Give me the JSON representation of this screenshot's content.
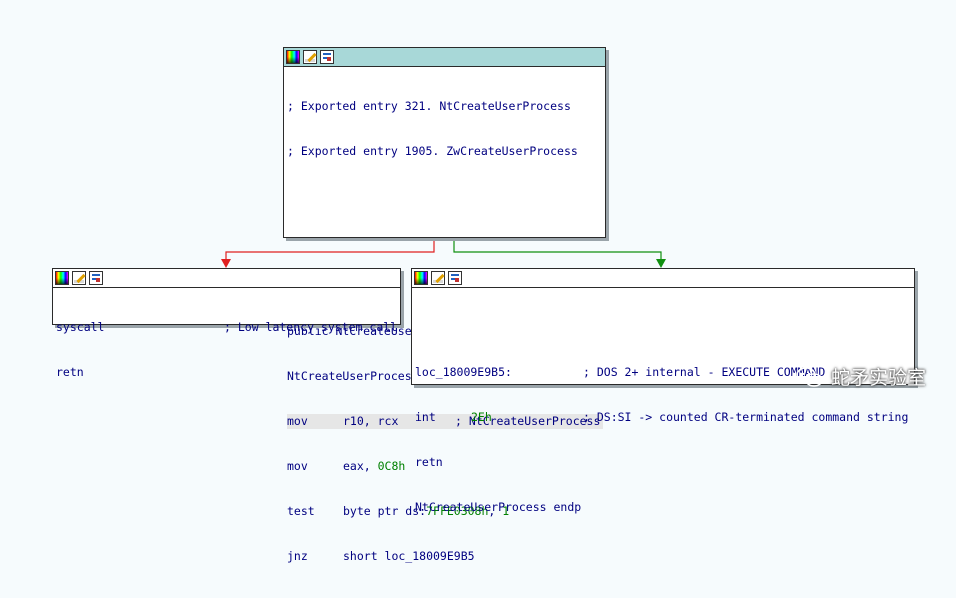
{
  "nodes": {
    "top": {
      "lines": [
        {
          "text": "; Exported entry 321. NtCreateUserProcess",
          "kind": "comment"
        },
        {
          "text": "; Exported entry 1905. ZwCreateUserProcess",
          "kind": "comment"
        },
        {
          "text": "",
          "kind": "blank"
        },
        {
          "text": "",
          "kind": "blank"
        },
        {
          "text": "",
          "kind": "blank"
        },
        {
          "text": "public NtCreateUserProcess",
          "kind": "text"
        },
        {
          "text": "NtCreateUserProcess proc near",
          "kind": "text"
        }
      ],
      "instructions": [
        {
          "mnem": "mov",
          "ops": "r10, rcx",
          "comment": "; NtCreateUserProcess",
          "highlight": true
        },
        {
          "mnem": "mov",
          "ops_prefix": "eax, ",
          "ops_num": "0C8h"
        },
        {
          "mnem": "test",
          "ops_prefix": "byte ptr ds:",
          "ops_addr": "7FFE0308h",
          "ops_suffix": ", ",
          "ops_num": "1"
        },
        {
          "mnem": "jnz",
          "ops": "short loc_18009E9B5"
        }
      ]
    },
    "left": {
      "instructions": [
        {
          "mnem": "syscall",
          "comment": "; Low latency system call"
        },
        {
          "mnem": "retn"
        }
      ]
    },
    "right": {
      "label": "loc_18009E9B5:",
      "label_comment": "; DOS 2+ internal - EXECUTE COMMAND",
      "instructions": [
        {
          "mnem": "int",
          "ops_num": "2Eh",
          "comment": "; DS:SI -> counted CR-terminated command string"
        },
        {
          "mnem": "retn"
        }
      ],
      "endp": "NtCreateUserProcess endp"
    }
  },
  "edges": {
    "false_branch_color": "#e02020",
    "true_branch_color": "#109010"
  },
  "watermark": {
    "text": "蛇矛实验室",
    "icon": "wechat-logo-icon"
  }
}
